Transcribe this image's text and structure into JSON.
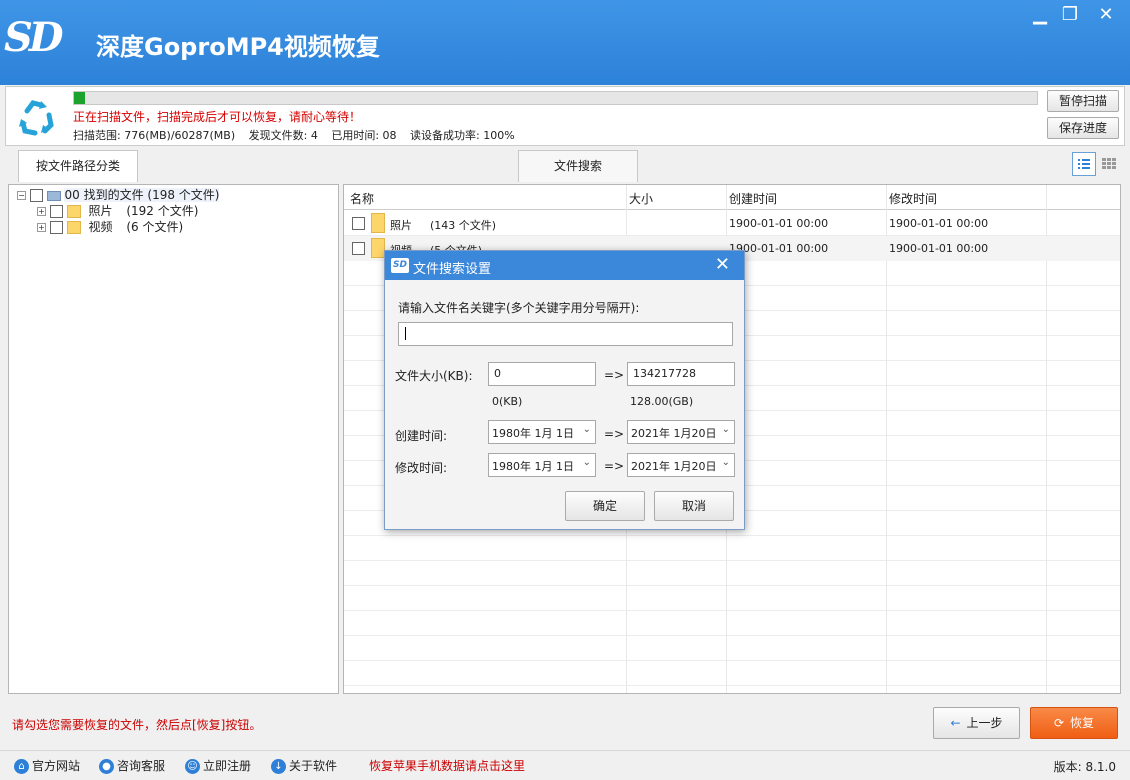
{
  "app": {
    "logo": "SD",
    "title": "深度GoproMP4视频恢复"
  },
  "window": {
    "minimize": "▁",
    "restore": "❐",
    "close": "✕"
  },
  "scan": {
    "progress_fraction": 0.011,
    "warning": "正在扫描文件，扫描完成后才可以恢复，请耐心等待！",
    "range": "扫描范围: 776(MB)/60287(MB)",
    "found": "发现文件数: 4",
    "elapsed": "已用时间: 08",
    "read_rate": "读设备成功率: 100%",
    "pause_label": "暂停扫描",
    "save_label": "保存进度"
  },
  "tabs": {
    "by_path": "按文件路径分类",
    "search": "文件搜索"
  },
  "tree": {
    "root": {
      "label": "00 找到的文件 (198 个文件)"
    },
    "items": [
      {
        "label": "照片",
        "count": "(192 个文件)"
      },
      {
        "label": "视频",
        "count": "(6 个文件)"
      }
    ]
  },
  "list": {
    "columns": [
      "名称",
      "大小",
      "创建时间",
      "修改时间"
    ],
    "rows": [
      {
        "name": "照片",
        "count": "(143 个文件)",
        "size": "",
        "created": "1900-01-01  00:00",
        "modified": "1900-01-01  00:00"
      },
      {
        "name": "视频",
        "count": "(5 个文件)",
        "size": "",
        "created": "1900-01-01  00:00",
        "modified": "1900-01-01  00:00"
      }
    ]
  },
  "dialog": {
    "icon": "SD",
    "title": "文件搜索设置",
    "close": "✕",
    "prompt": "请输入文件名关键字(多个关键字用分号隔开):",
    "keyword_value": "",
    "size_label": "文件大小(KB):",
    "size_min": "0",
    "size_max": "134217728",
    "arrow": "=>",
    "size_min_hint": "0(KB)",
    "size_max_hint": "128.00(GB)",
    "created_label": "创建时间:",
    "created_from": "1980年  1月  1日",
    "created_to": "2021年  1月20日",
    "modified_label": "修改时间:",
    "modified_from": "1980年  1月  1日",
    "modified_to": "2021年  1月20日",
    "ok_label": "确定",
    "cancel_label": "取消"
  },
  "footer": {
    "hint": "请勾选您需要恢复的文件，然后点[恢复]按钮。",
    "prev_label": "上一步",
    "recover_label": "恢复"
  },
  "status": {
    "website": "官方网站",
    "support": "咨询客服",
    "register": "立即注册",
    "about": "关于软件",
    "promo": "恢复苹果手机数据请点击这里",
    "version": "版本: 8.1.0"
  },
  "colors": {
    "titlebar": "#2d82d9",
    "progress": "#1ba32e",
    "warning": "#d60000",
    "recover": "#f36c21"
  }
}
